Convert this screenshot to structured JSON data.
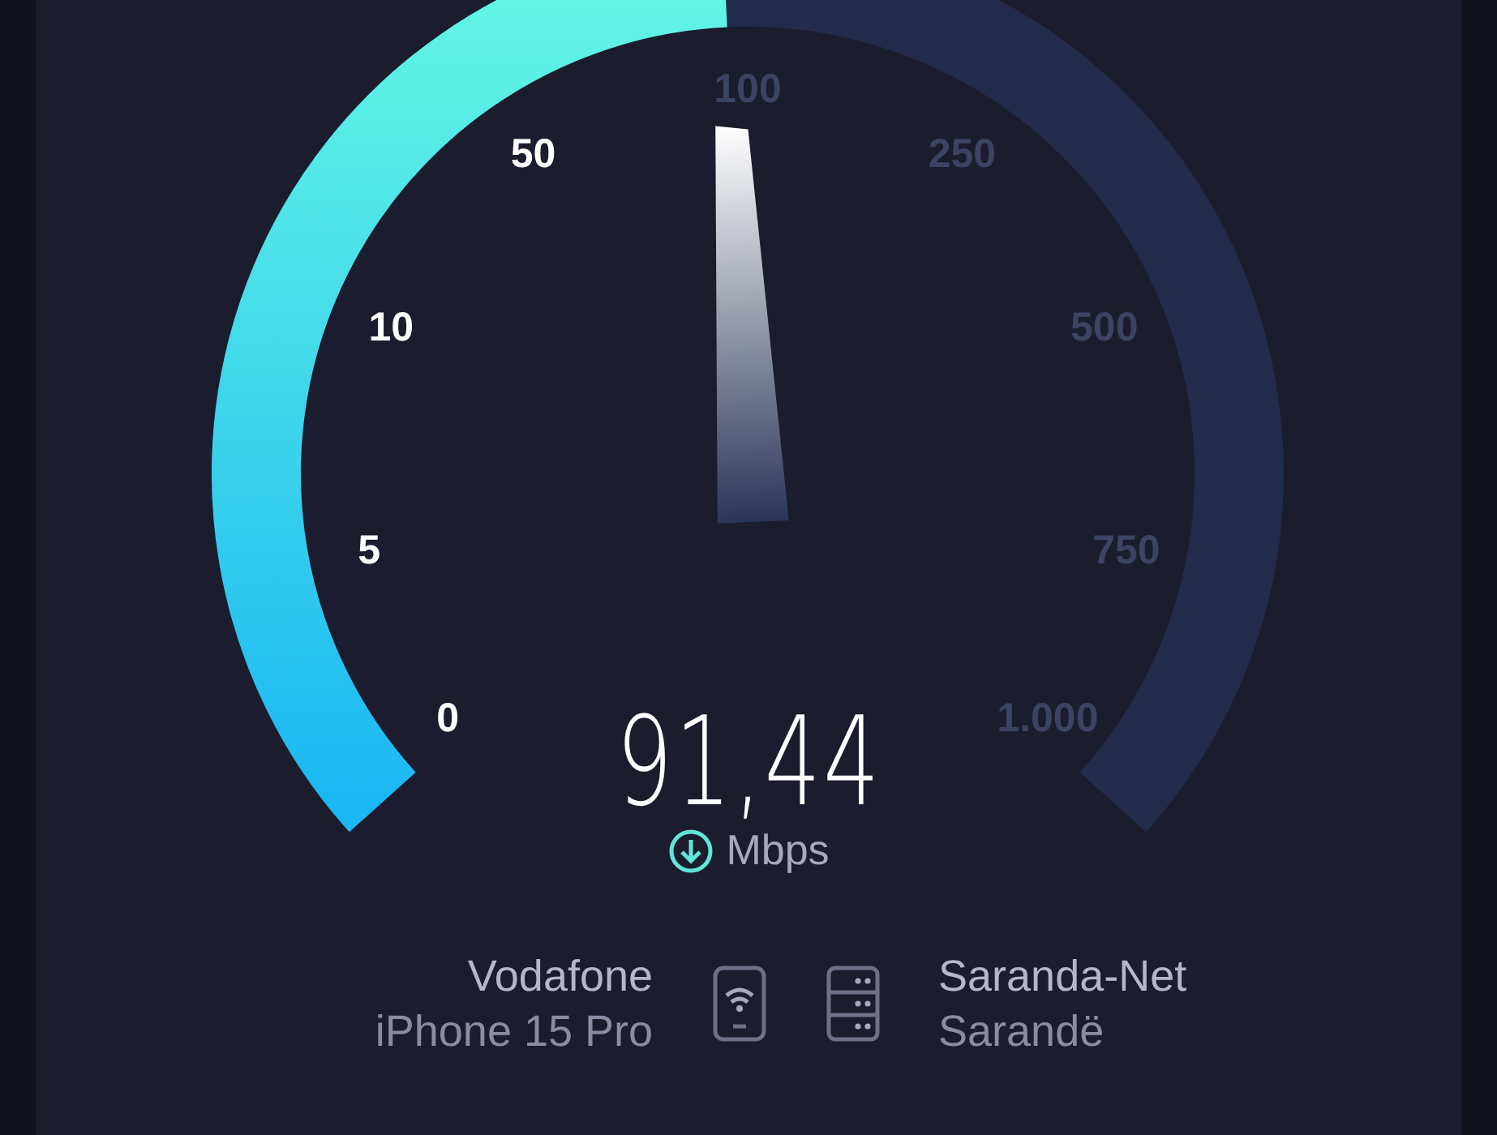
{
  "gauge": {
    "ticks": [
      {
        "label": "0",
        "passed": true
      },
      {
        "label": "5",
        "passed": true
      },
      {
        "label": "10",
        "passed": true
      },
      {
        "label": "50",
        "passed": true
      },
      {
        "label": "100",
        "passed": false
      },
      {
        "label": "250",
        "passed": false
      },
      {
        "label": "500",
        "passed": false
      },
      {
        "label": "750",
        "passed": false
      },
      {
        "label": "1.000",
        "passed": false
      }
    ]
  },
  "result": {
    "value": "91,44",
    "unit": "Mbps"
  },
  "provider": {
    "name": "Vodafone",
    "device": "iPhone 15 Pro"
  },
  "server": {
    "name": "Saranda-Net",
    "location": "Sarandë"
  }
}
